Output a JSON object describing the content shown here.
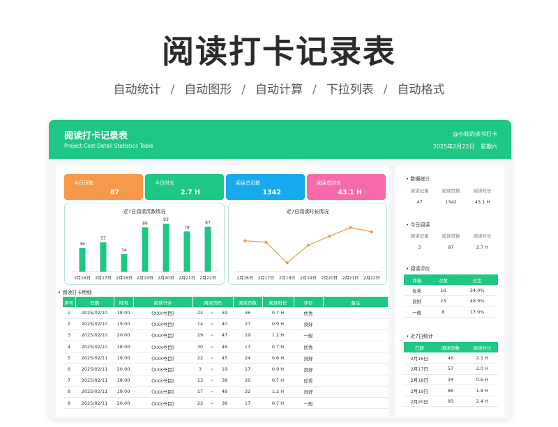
{
  "page": {
    "title": "阅读打卡记录表",
    "features": [
      "自动统计",
      "自动图形",
      "自动计算",
      "下拉列表",
      "自动格式"
    ],
    "separator": "/"
  },
  "header": {
    "title": "阅读打卡记录表",
    "subtitle": "Project Cost Detail Statistics Table",
    "author": "@小软的读书打卡",
    "date": "2025年2月22日",
    "weekday": "星期六"
  },
  "stats": [
    {
      "label": "今日页数",
      "value": "87",
      "color": "#f7984a"
    },
    {
      "label": "今日时长",
      "value": "2.7 H",
      "color": "#1ec783"
    },
    {
      "label": "阅读总页数",
      "value": "1342",
      "color": "#19a9ef"
    },
    {
      "label": "阅读总时长",
      "value": "43.1 H",
      "color": "#f76aa9"
    }
  ],
  "bar_chart_title": "近7日阅读页数情况",
  "line_chart_title": "近7日阅读时长情况",
  "chart_data": [
    {
      "type": "bar",
      "title": "近7日阅读页数情况",
      "categories": [
        "2月16日",
        "2月17日",
        "2月18日",
        "2月19日",
        "2月20日",
        "2月21日",
        "2月22日"
      ],
      "values": [
        46,
        57,
        34,
        86,
        93,
        78,
        87
      ],
      "ylim": [
        0,
        100
      ],
      "color": "#1ec783",
      "grid": false
    },
    {
      "type": "line",
      "title": "近7日阅读时长情况",
      "categories": [
        "2月16日",
        "2月17日",
        "2月18日",
        "2月19日",
        "2月20日",
        "2月21日",
        "2月22日"
      ],
      "values": [
        2.1,
        2.0,
        0.6,
        1.8,
        2.4,
        3.0,
        2.7
      ],
      "ylim": [
        0,
        3.5
      ],
      "color": "#f0a04b",
      "grid": false
    }
  ],
  "detail": {
    "title": "阅读打卡明细",
    "headers": [
      "序号",
      "日期",
      "时间",
      "阅读书本",
      "阅读页码",
      "阅读页数",
      "阅读时长",
      "评价",
      "备注"
    ],
    "rows": [
      [
        "1",
        "2025/02/10",
        "18:00",
        "《XXX书目》",
        "24",
        "~",
        "59",
        "36",
        "0.7 H",
        "优秀",
        ""
      ],
      [
        "2",
        "2025/02/10",
        "19:00",
        "《XXX书目》",
        "14",
        "~",
        "40",
        "27",
        "0.9 H",
        "良好",
        ""
      ],
      [
        "3",
        "2025/02/10",
        "20:00",
        "《XXX书目》",
        "29",
        "~",
        "47",
        "19",
        "1.2 H",
        "一般",
        ""
      ],
      [
        "4",
        "2025/02/10",
        "18:00",
        "《XXX书目》",
        "30",
        "~",
        "46",
        "17",
        "0.7 H",
        "优秀",
        ""
      ],
      [
        "5",
        "2025/02/11",
        "19:00",
        "《XXX书目》",
        "22",
        "~",
        "45",
        "24",
        "0.6 H",
        "良好",
        ""
      ],
      [
        "6",
        "2025/02/11",
        "20:00",
        "《XXX书目》",
        "3",
        "~",
        "19",
        "17",
        "0.9 H",
        "良好",
        ""
      ],
      [
        "7",
        "2025/02/11",
        "18:00",
        "《XXX书目》",
        "13",
        "~",
        "38",
        "26",
        "0.7 H",
        "优秀",
        ""
      ],
      [
        "8",
        "2025/02/11",
        "19:00",
        "《XXX书目》",
        "17",
        "~",
        "48",
        "32",
        "1.2 H",
        "良好",
        ""
      ],
      [
        "9",
        "2025/02/11",
        "20:00",
        "《XXX书目》",
        "22",
        "~",
        "38",
        "17",
        "0.7 H",
        "一般",
        ""
      ]
    ]
  },
  "side": {
    "summary": {
      "title": "数据统计",
      "headers": [
        "阅读记录",
        "阅读页数",
        "阅读时长"
      ],
      "values": [
        "47",
        "1342",
        "43.1 H"
      ]
    },
    "today": {
      "title": "今日阅读",
      "headers": [
        "阅读记录",
        "阅读页数",
        "阅读时长"
      ],
      "values": [
        "3",
        "87",
        "2.7 H"
      ]
    },
    "rating": {
      "title": "阅读评价",
      "headers": [
        "评级",
        "次数",
        "占比"
      ],
      "rows": [
        [
          "优秀",
          "16",
          "34.0%"
        ],
        [
          "良好",
          "23",
          "48.9%"
        ],
        [
          "一般",
          "8",
          "17.0%"
        ]
      ]
    },
    "recent": {
      "title": "近7日统计",
      "headers": [
        "日期",
        "阅读页数",
        "阅读时长"
      ],
      "rows": [
        [
          "2月16日",
          "46",
          "2.1 H"
        ],
        [
          "2月17日",
          "57",
          "2.0 H"
        ],
        [
          "2月18日",
          "34",
          "0.6 H"
        ],
        [
          "2月19日",
          "86",
          "1.8 H"
        ],
        [
          "2月20日",
          "93",
          "2.4 H"
        ]
      ]
    }
  }
}
